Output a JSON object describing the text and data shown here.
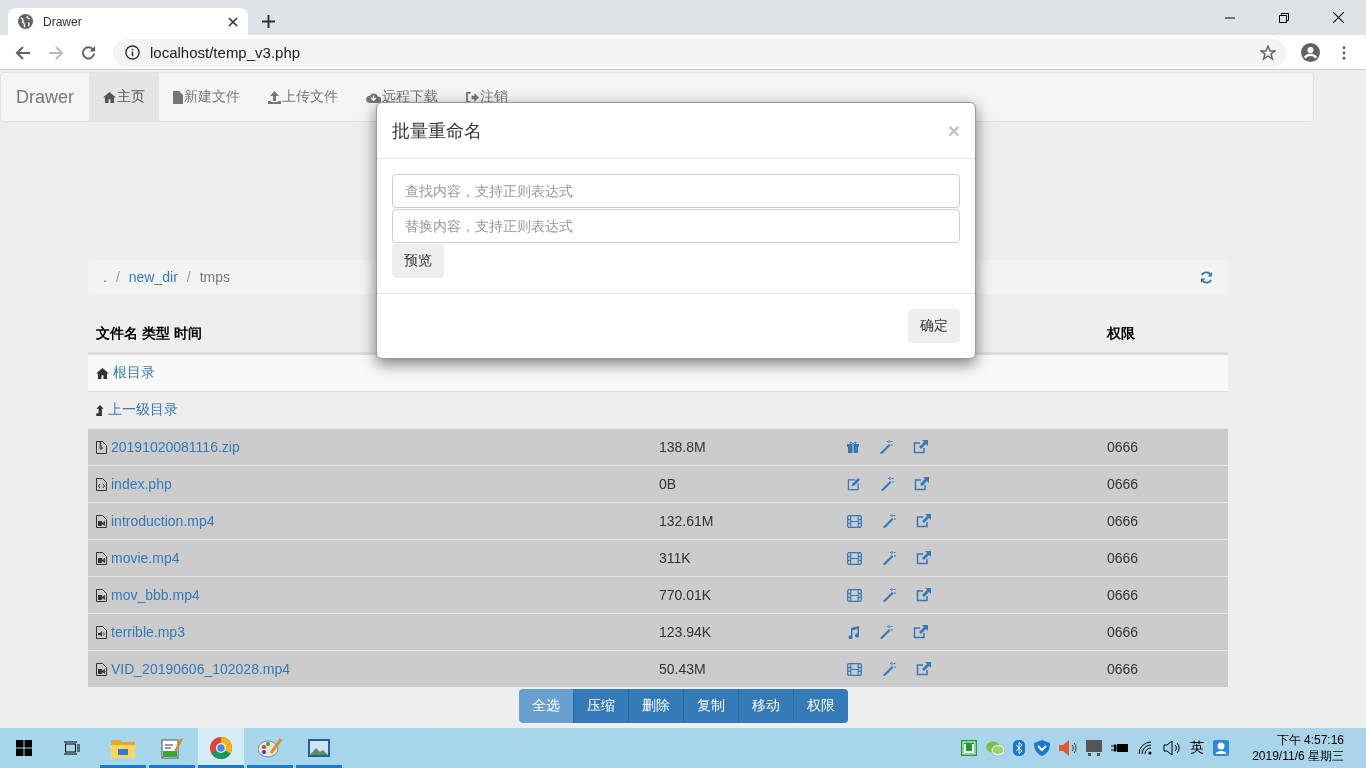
{
  "browser": {
    "tab_title": "Drawer",
    "url": "localhost/temp_v3.php"
  },
  "navbar": {
    "brand": "Drawer",
    "items": [
      {
        "label": "主页",
        "selected": true
      },
      {
        "label": "新建文件",
        "selected": false
      },
      {
        "label": "上传文件",
        "selected": false
      },
      {
        "label": "远程下载",
        "selected": false
      },
      {
        "label": "注销",
        "selected": false
      }
    ]
  },
  "breadcrumb": {
    "items": [
      ".",
      "new_dir",
      "tmps"
    ],
    "separator": "/"
  },
  "table": {
    "columns": [
      "文件名 类型 时间",
      "权限"
    ],
    "nav_rows": [
      {
        "kind": "root",
        "label": "根目录"
      },
      {
        "kind": "up",
        "label": "上一级目录"
      }
    ],
    "rows": [
      {
        "name": "20191020081116.zip",
        "kind": "zip",
        "size": "138.8M",
        "permission": "0666",
        "selected": true
      },
      {
        "name": "index.php",
        "kind": "code",
        "size": "0B",
        "permission": "0666",
        "selected": true
      },
      {
        "name": "introduction.mp4",
        "kind": "video",
        "size": "132.61M",
        "permission": "0666",
        "selected": true
      },
      {
        "name": "movie.mp4",
        "kind": "video",
        "size": "311K",
        "permission": "0666",
        "selected": true
      },
      {
        "name": "mov_bbb.mp4",
        "kind": "video",
        "size": "770.01K",
        "permission": "0666",
        "selected": true
      },
      {
        "name": "terrible.mp3",
        "kind": "audio",
        "size": "123.94K",
        "permission": "0666",
        "selected": true
      },
      {
        "name": "VID_20190606_102028.mp4",
        "kind": "video",
        "size": "50.43M",
        "permission": "0666",
        "selected": true
      }
    ]
  },
  "actions": [
    {
      "label": "全选",
      "selected": true
    },
    {
      "label": "压缩",
      "selected": false
    },
    {
      "label": "删除",
      "selected": false
    },
    {
      "label": "复制",
      "selected": false
    },
    {
      "label": "移动",
      "selected": false
    },
    {
      "label": "权限",
      "selected": false
    }
  ],
  "modal": {
    "title": "批量重命名",
    "close": "×",
    "fields": [
      {
        "placeholder": "查找内容，支持正则表达式"
      },
      {
        "placeholder": "替换内容，支持正则表达式"
      }
    ],
    "preview_button": "预览",
    "confirm_button": "确定"
  },
  "taskbar": {
    "apps": [
      {
        "selected": false
      },
      {
        "selected": false
      },
      {
        "selected": true
      },
      {
        "selected": false
      },
      {
        "selected": false
      }
    ],
    "ime": "英",
    "time": "下午 4:57:16",
    "date": "2019/11/6 星期三"
  }
}
